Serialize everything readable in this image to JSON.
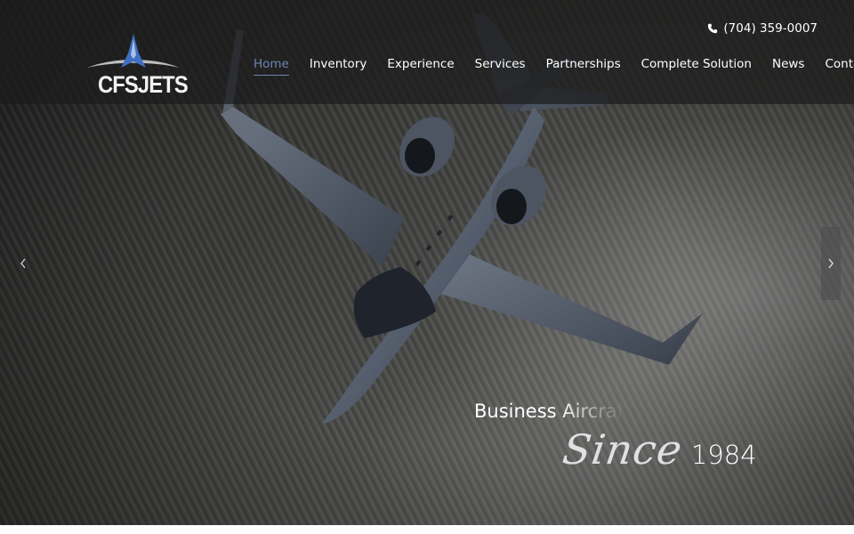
{
  "brand": {
    "logo_text": "CFSJETS"
  },
  "header": {
    "phone": "(704) 359-0007",
    "nav": [
      {
        "label": "Home",
        "active": true
      },
      {
        "label": "Inventory",
        "active": false
      },
      {
        "label": "Experience",
        "active": false
      },
      {
        "label": "Services",
        "active": false
      },
      {
        "label": "Partnerships",
        "active": false
      },
      {
        "label": "Complete Solution",
        "active": false
      },
      {
        "label": "News",
        "active": false
      },
      {
        "label": "Contact",
        "active": false
      }
    ]
  },
  "slider": {
    "caption_line1_visible": "Business ",
    "caption_line1_fading": "Aircraf",
    "caption_since": "Since",
    "caption_year": "1984",
    "prev_icon": "chevron-left-icon",
    "next_icon": "chevron-right-icon"
  },
  "colors": {
    "accent": "#6d86b0",
    "header_bg": "#1c1c1c",
    "logo_blue": "#3f6fc2"
  }
}
